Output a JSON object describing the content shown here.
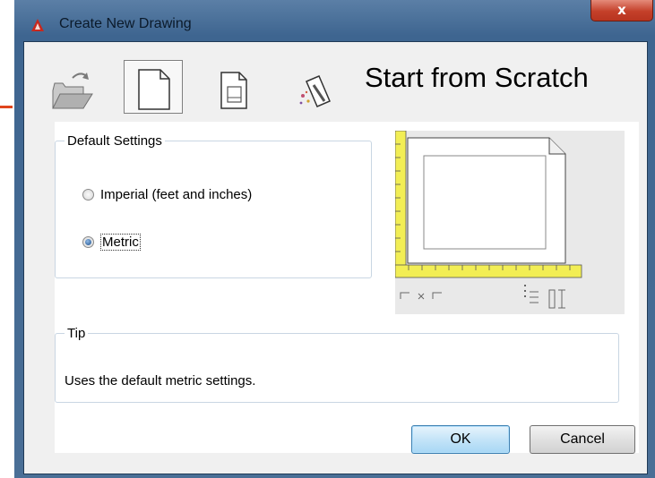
{
  "window": {
    "title": "Create New Drawing",
    "close_label": "x"
  },
  "toolbar": {
    "items": [
      {
        "name": "open-drawing",
        "icon": "folder-open-icon"
      },
      {
        "name": "start-from-scratch",
        "icon": "blank-page-icon",
        "active": true
      },
      {
        "name": "use-template",
        "icon": "template-page-icon"
      },
      {
        "name": "use-wizard",
        "icon": "wizard-icon"
      }
    ]
  },
  "heading": "Start from Scratch",
  "default_settings": {
    "legend": "Default Settings",
    "options": [
      {
        "label": "Imperial (feet and inches)",
        "checked": false
      },
      {
        "label": "Metric",
        "checked": true
      }
    ]
  },
  "tip": {
    "legend": "Tip",
    "text": "Uses the default metric settings."
  },
  "buttons": {
    "ok": "OK",
    "cancel": "Cancel"
  },
  "colors": {
    "title_bar": "#4a6f96",
    "close_button": "#c4402a",
    "ruler": "#f2ee55",
    "default_button": "#a7d7f5"
  }
}
